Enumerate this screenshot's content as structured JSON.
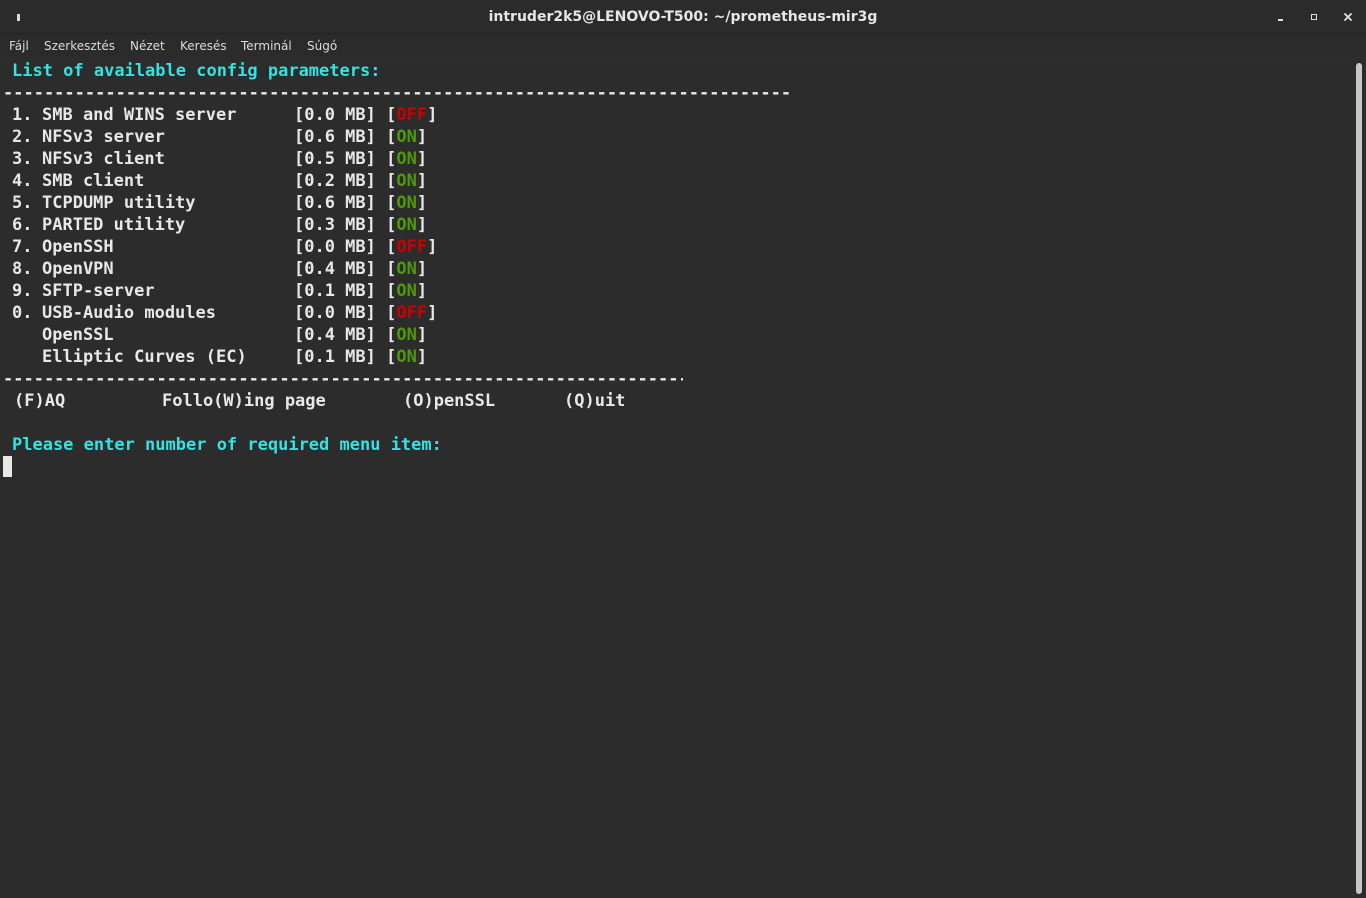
{
  "window": {
    "title": "intruder2k5@LENOVO-T500: ~/prometheus-mir3g"
  },
  "menubar": {
    "items": [
      "Fájl",
      "Szerkesztés",
      "Nézet",
      "Keresés",
      "Terminál",
      "Súgó"
    ]
  },
  "terminal": {
    "heading": "List of available config parameters:",
    "separator_top": "----------------------------------------------------------------------------------------------------------------",
    "separator_bottom": "----------------------------------------------------------------------------------------------------------------",
    "params": [
      {
        "num": "1.",
        "name": "SMB and WINS server",
        "size": "[0.0 MB]",
        "status": "OFF"
      },
      {
        "num": "2.",
        "name": "NFSv3 server",
        "size": "[0.6 MB]",
        "status": "ON"
      },
      {
        "num": "3.",
        "name": "NFSv3 client",
        "size": "[0.5 MB]",
        "status": "ON"
      },
      {
        "num": "4.",
        "name": "SMB client",
        "size": "[0.2 MB]",
        "status": "ON"
      },
      {
        "num": "5.",
        "name": "TCPDUMP utility",
        "size": "[0.6 MB]",
        "status": "ON"
      },
      {
        "num": "6.",
        "name": "PARTED utility",
        "size": "[0.3 MB]",
        "status": "ON"
      },
      {
        "num": "7.",
        "name": "OpenSSH",
        "size": "[0.0 MB]",
        "status": "OFF"
      },
      {
        "num": "8.",
        "name": "OpenVPN",
        "size": "[0.4 MB]",
        "status": "ON"
      },
      {
        "num": "9.",
        "name": "SFTP-server",
        "size": "[0.1 MB]",
        "status": "ON"
      },
      {
        "num": "0.",
        "name": "USB-Audio modules",
        "size": "[0.0 MB]",
        "status": "OFF"
      },
      {
        "num": "",
        "name": "OpenSSL",
        "size": "[0.4 MB]",
        "status": "ON"
      },
      {
        "num": "",
        "name": "Elliptic Curves (EC)",
        "size": "[0.1 MB]",
        "status": "ON"
      }
    ],
    "footer": {
      "faq": "(F)AQ",
      "following": "Follo(W)ing page",
      "openssl": "(O)penSSL",
      "quit": "(Q)uit"
    },
    "prompt": "Please enter number of required menu item:"
  },
  "colors": {
    "background": "#2c2c2c",
    "text": "#e8e8e8",
    "cyan": "#34e2e2",
    "on": "#4e9a06",
    "off": "#cc0000"
  }
}
